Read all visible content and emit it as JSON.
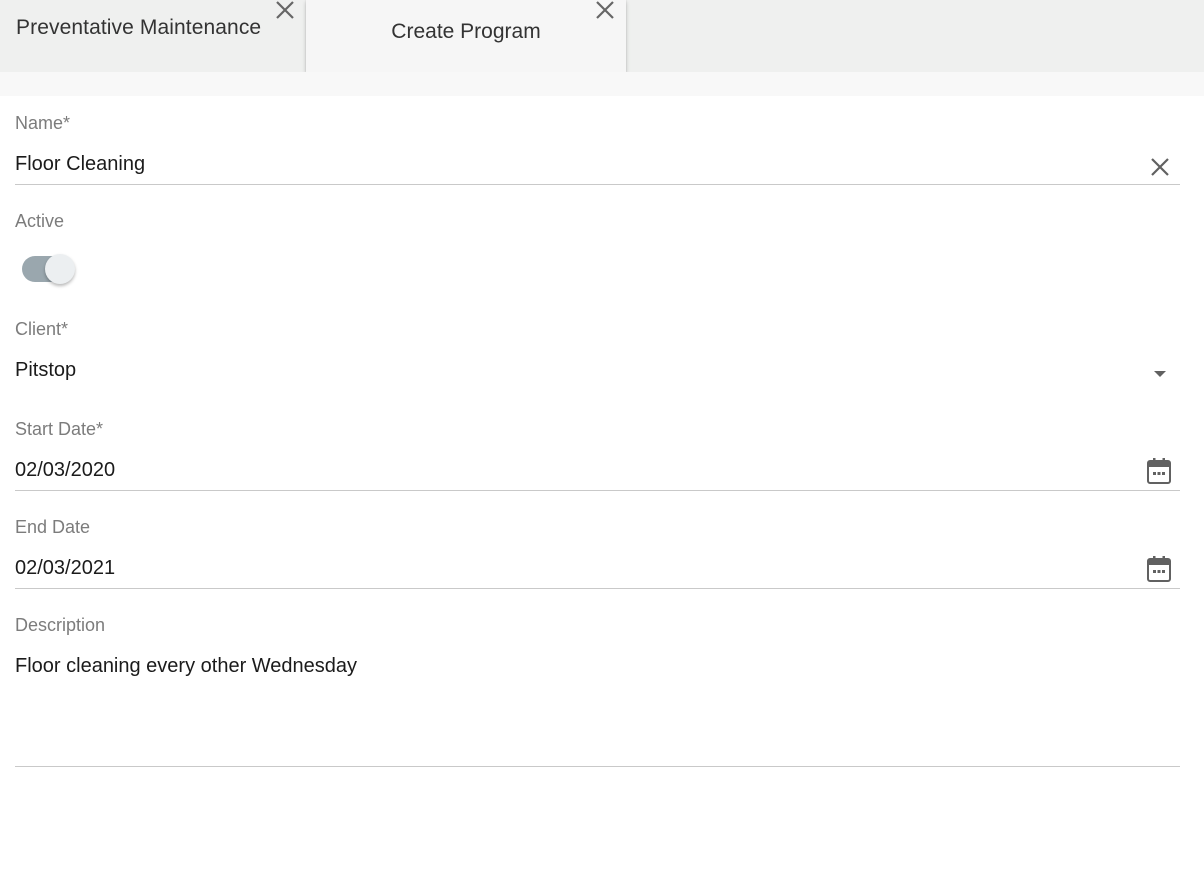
{
  "tabs": [
    {
      "label": "Preventative Maintenance",
      "active": false
    },
    {
      "label": "Create Program",
      "active": true
    }
  ],
  "form": {
    "name": {
      "label": "Name*",
      "value": "Floor Cleaning"
    },
    "active": {
      "label": "Active",
      "checked": true
    },
    "client": {
      "label": "Client*",
      "value": "Pitstop"
    },
    "start_date": {
      "label": "Start Date*",
      "value": "02/03/2020"
    },
    "end_date": {
      "label": "End Date",
      "value": "02/03/2021"
    },
    "description": {
      "label": "Description",
      "value": "Floor cleaning every other Wednesday"
    }
  },
  "icons": {
    "tab_close": "close-icon",
    "clear": "close-icon",
    "dropdown": "chevron-down-icon",
    "calendar": "calendar-icon"
  },
  "colors": {
    "tabbar_bg": "#eff0ef",
    "active_tab_bg": "#f6f6f6",
    "label": "#7c7c7c",
    "text": "#1b1b1b",
    "toggle_track": "#9aa7ae",
    "toggle_thumb": "#eceff1",
    "icon": "#616161"
  }
}
